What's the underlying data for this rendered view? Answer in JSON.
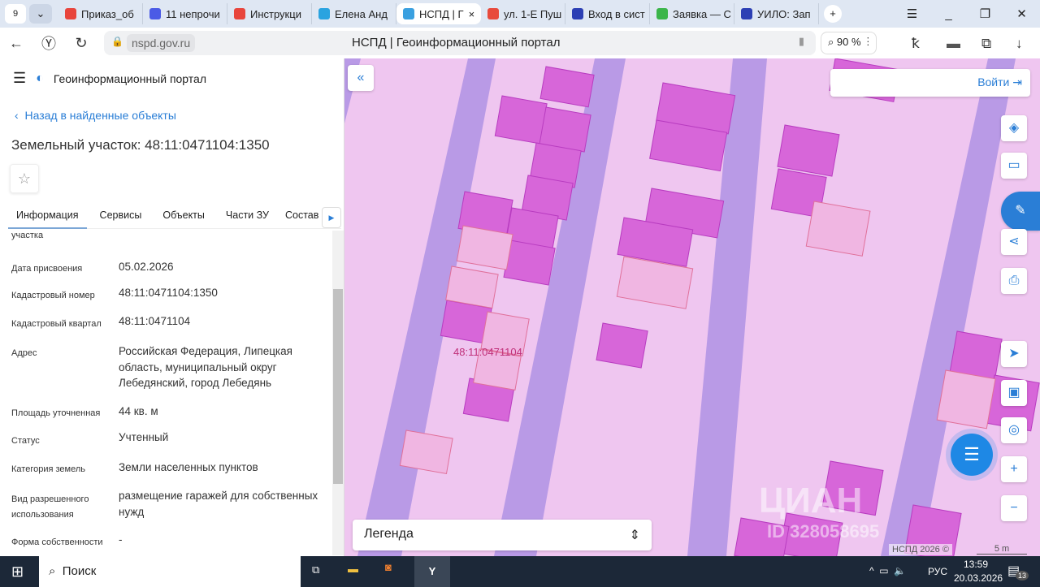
{
  "browser": {
    "tab_count": "9",
    "tabs": [
      {
        "label": "Приказ_об",
        "color": "#e8453c"
      },
      {
        "label": "11 непрочи",
        "color": "#4b5be6"
      },
      {
        "label": "Инструкци",
        "color": "#e8453c"
      },
      {
        "label": "Елена Анд",
        "color": "#2aa3e0"
      },
      {
        "label": "НСПД | Г",
        "color": "#3aa0e0",
        "active": true
      },
      {
        "label": "ул. 1-Е Пуш",
        "color": "#e84a3c"
      },
      {
        "label": "Вход в сист",
        "color": "#2c3fb4"
      },
      {
        "label": "Заявка — С",
        "color": "#3bb54a"
      },
      {
        "label": "УИЛО: Зап",
        "color": "#2c3fb4"
      }
    ],
    "url": "nspd.gov.ru",
    "page_title": "НСПД | Геоинформационный портал",
    "zoom": "90 %"
  },
  "panel": {
    "portal_name": "Геоинформационный портал",
    "back_link": "Назад в найденные объекты",
    "title": "Земельный участок: 48:11:0471104:1350",
    "tabs": [
      "Информация",
      "Сервисы",
      "Объекты",
      "Части ЗУ",
      "Состав"
    ],
    "cut_label": "участка",
    "rows": [
      {
        "label": "Дата присвоения",
        "value": "05.02.2026"
      },
      {
        "label": "Кадастровый номер",
        "value": "48:11:0471104:1350"
      },
      {
        "label": "Кадастровый квартал",
        "value": "48:11:0471104"
      },
      {
        "label": "Адрес",
        "value": "Российская Федерация, Липецкая область, муниципальный округ Лебедянский, город Лебедянь"
      },
      {
        "label": "Площадь уточненная",
        "value": "44 кв. м"
      },
      {
        "label": "Статус",
        "value": "Учтенный"
      },
      {
        "label": "Категория земель",
        "value": "Земли населенных пунктов"
      },
      {
        "label": "Вид разрешенного использования",
        "value": "размещение гаражей для собственных нужд"
      },
      {
        "label": "Форма собственности",
        "value": "-"
      }
    ]
  },
  "map": {
    "login": "Войти",
    "quarter_label": "48:11:0471104",
    "legend": "Легенда",
    "copyright": "НСПД 2026 ©",
    "scale": "5 m",
    "watermark": "ЦИАН",
    "watermark_id": "ID 328058695"
  },
  "taskbar": {
    "search": "Поиск",
    "lang": "РУС",
    "time": "13:59",
    "date": "20.03.2026",
    "notifications": "13"
  }
}
